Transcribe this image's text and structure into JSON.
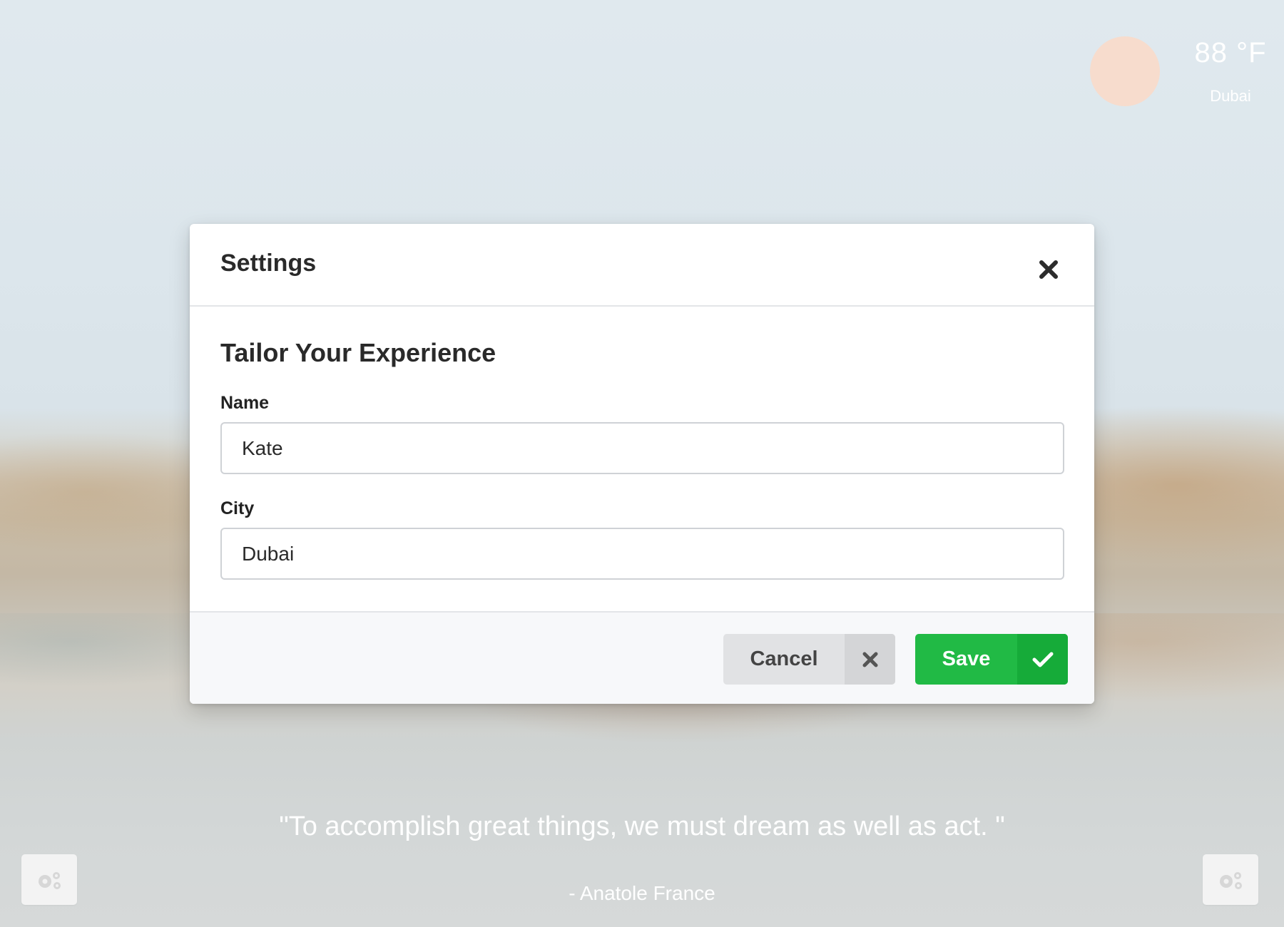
{
  "weather": {
    "temperature": "88 °F",
    "city": "Dubai",
    "icon": "sun-icon"
  },
  "quote": {
    "text": "\"To accomplish great things, we must dream as well as act. \"",
    "author": "- Anatole France"
  },
  "corner_buttons": {
    "left_icon": "gears-icon",
    "right_icon": "gears-icon"
  },
  "modal": {
    "title": "Settings",
    "close_icon": "close-icon",
    "heading": "Tailor Your Experience",
    "fields": {
      "name": {
        "label": "Name",
        "value": "Kate"
      },
      "city": {
        "label": "City",
        "value": "Dubai"
      }
    },
    "buttons": {
      "cancel": {
        "label": "Cancel",
        "icon": "close-icon"
      },
      "save": {
        "label": "Save",
        "icon": "checkmark-icon"
      }
    }
  },
  "colors": {
    "save_green": "#21ba45",
    "save_green_dark": "#16ab39",
    "cancel_gray": "#e1e2e4",
    "sun": "#f7dccd"
  }
}
